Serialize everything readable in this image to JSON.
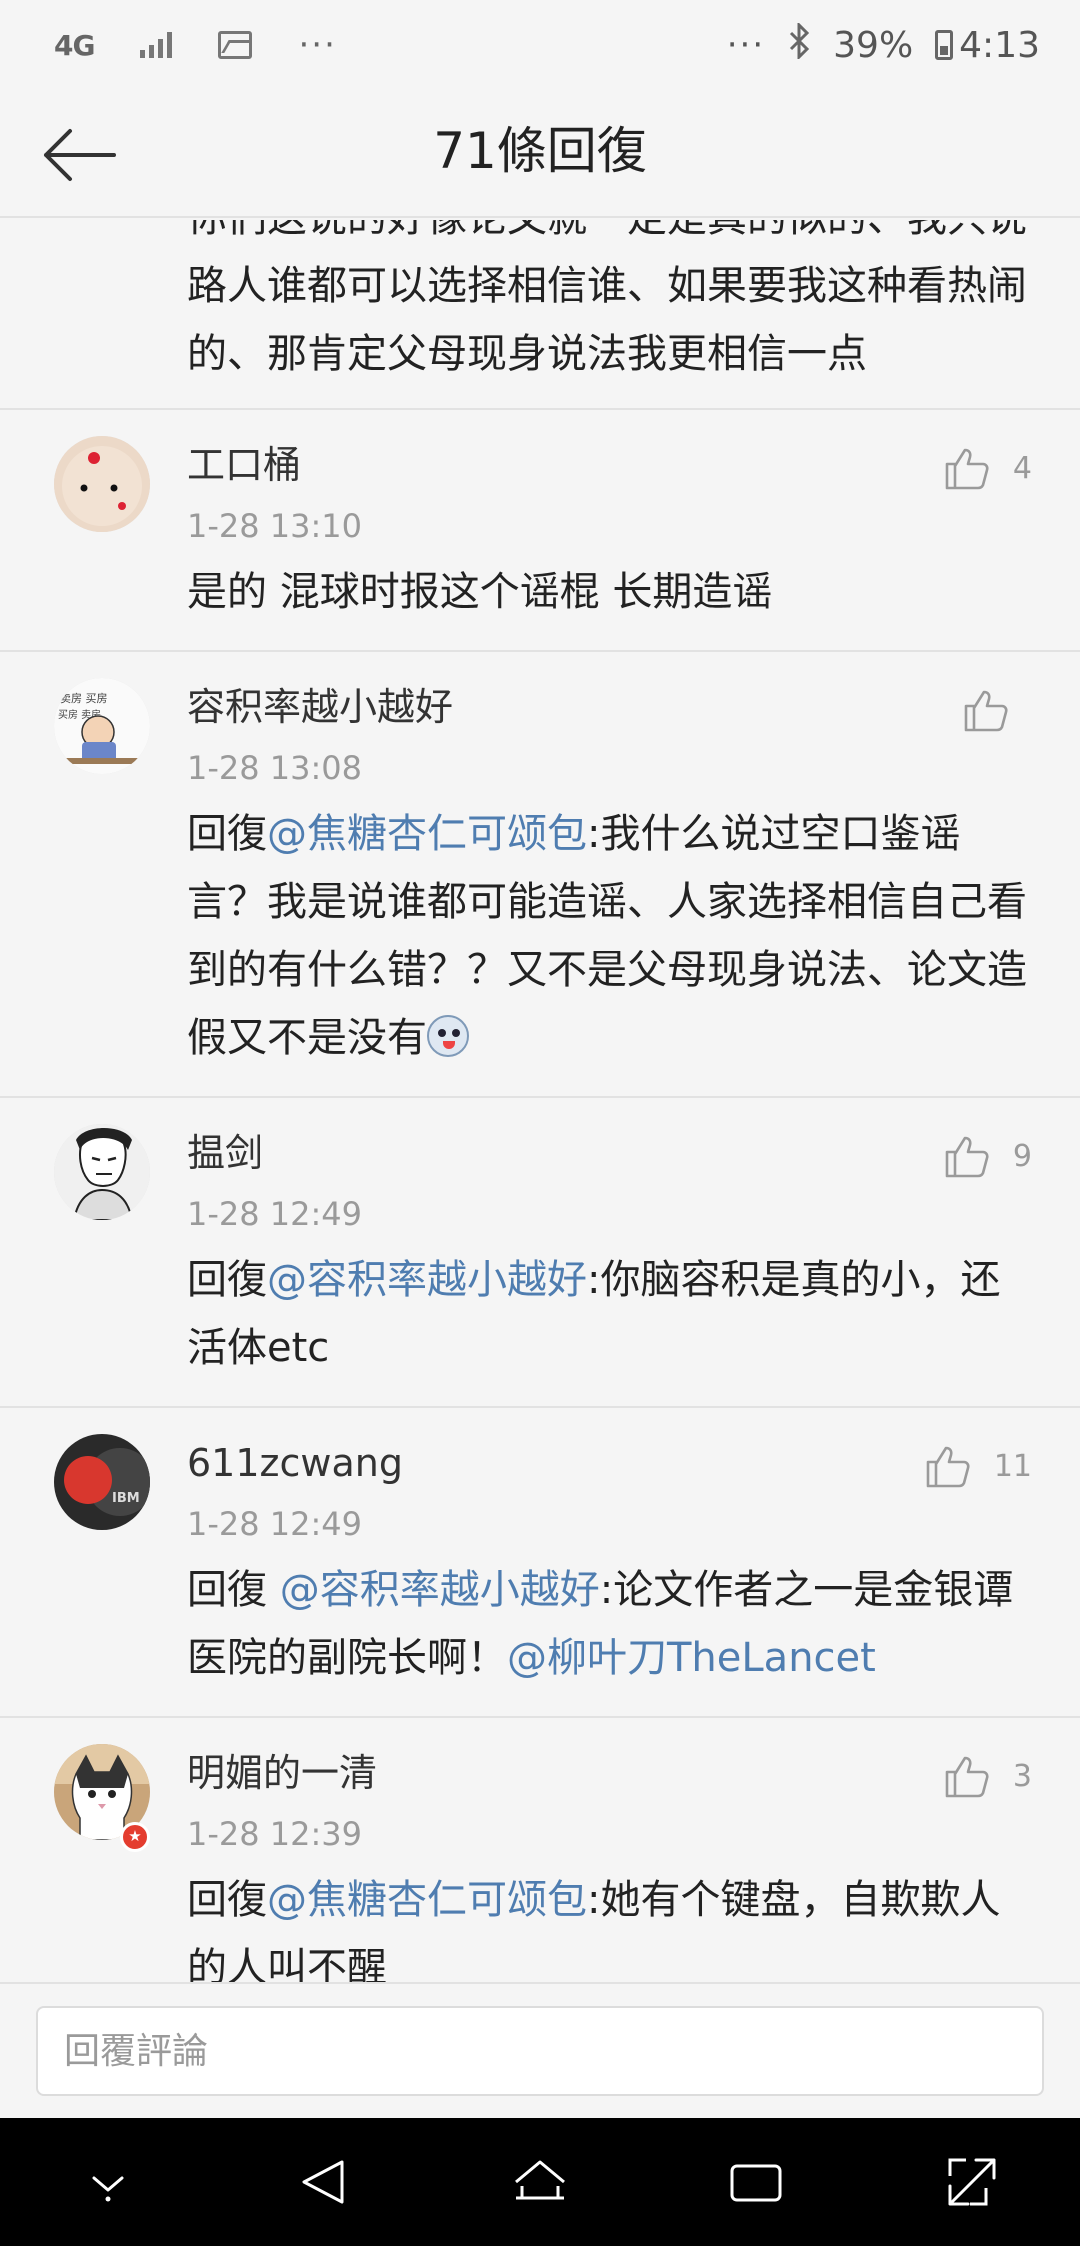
{
  "status_bar": {
    "network": "4G",
    "dots_left": "···",
    "dots_right": "···",
    "battery": "39%",
    "time": "4:13"
  },
  "header": {
    "title": "71條回復"
  },
  "partial_comment": {
    "text": "你们这说的好像论文就一定是真的似的、我只说路人谁都可以选择相信谁、如果要我这种看热闹的、那肯定父母现身说法我更相信一点"
  },
  "comments": [
    {
      "name": "工口桶",
      "time": "1-28 13:10",
      "likes": "4",
      "reply_prefix": "",
      "mention": "",
      "text": "是的 混球时报这个谣棍 长期造谣"
    },
    {
      "name": "容积率越小越好",
      "time": "1-28 13:08",
      "likes": "",
      "reply_prefix": "回復",
      "mention": "@焦糖杏仁可颂包",
      "text": ":我什么说过空口鉴谣言？我是说谁都可能造谣、人家选择相信自己看到的有什么错？？又不是父母现身说法、论文造假又不是没有"
    },
    {
      "name": "揾剑",
      "time": "1-28 12:49",
      "likes": "9",
      "reply_prefix": "回復",
      "mention": "@容积率越小越好",
      "text": ":你脑容积是真的小，还活体etc"
    },
    {
      "name": "611zcwang",
      "time": "1-28 12:49",
      "likes": "11",
      "reply_prefix": "回復 ",
      "mention": "@容积率越小越好",
      "text": ":论文作者之一是金银谭医院的副院长啊！",
      "mention2": "@柳叶刀TheLancet"
    },
    {
      "name": "明媚的一清",
      "time": "1-28 12:39",
      "likes": "3",
      "reply_prefix": "回復",
      "mention": "@焦糖杏仁可颂包",
      "text": ":她有个键盘，自欺欺人的人叫不醒"
    }
  ],
  "reply_bar": {
    "placeholder": "回覆評論"
  },
  "colors": {
    "mention": "#4f7db0",
    "background": "#f5f5f5",
    "time": "#9a9a9a"
  }
}
